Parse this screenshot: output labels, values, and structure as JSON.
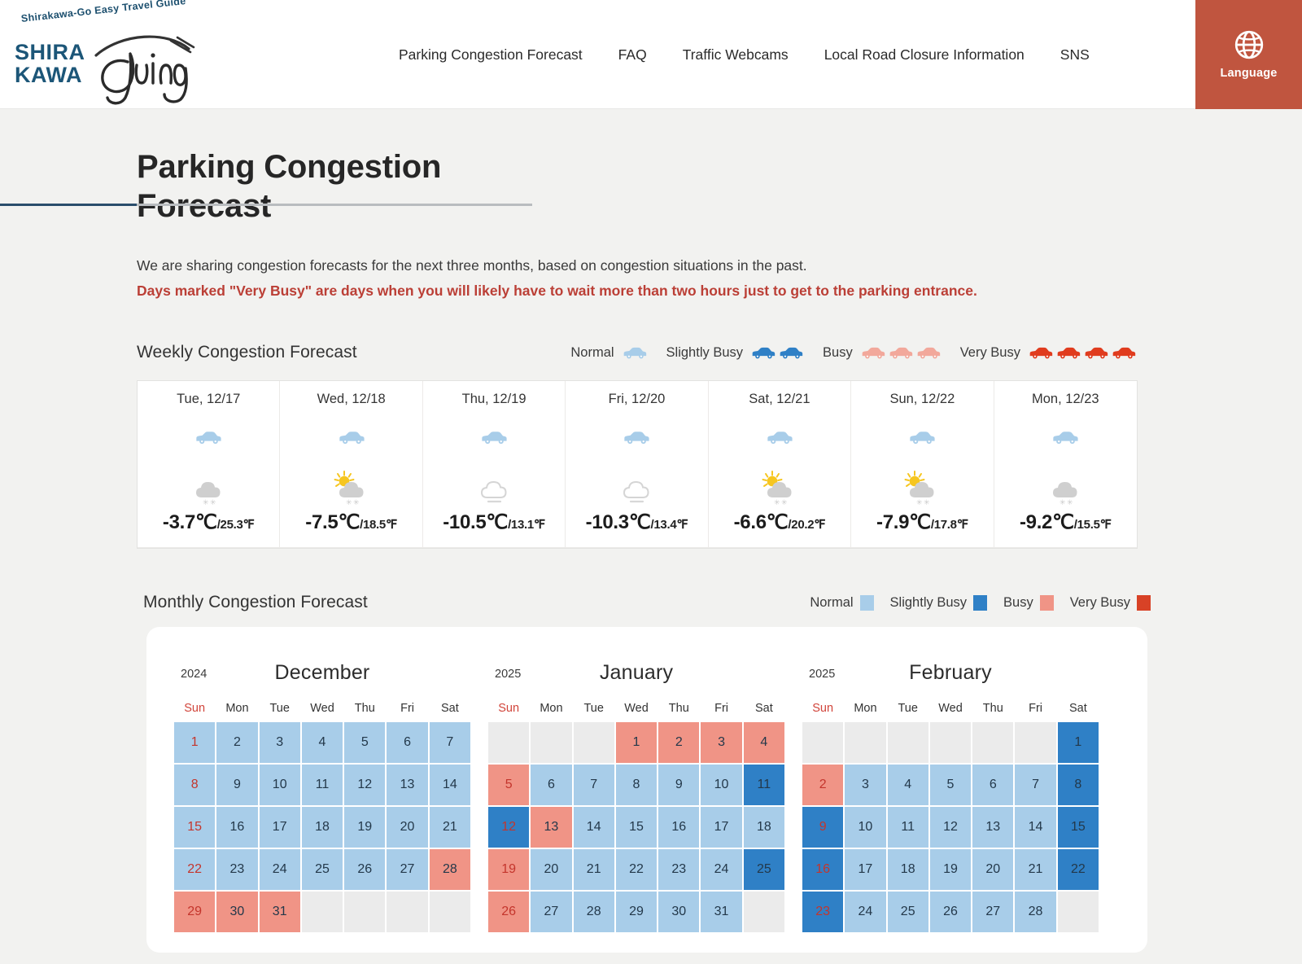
{
  "header": {
    "logo": {
      "tagline": "Shirakawa-Go Easy Travel Guide",
      "name_line1": "SHIRA",
      "name_line2": "KAWA",
      "script_word": "Going"
    },
    "nav": [
      {
        "label": "Parking Congestion Forecast"
      },
      {
        "label": "FAQ"
      },
      {
        "label": "Traffic Webcams"
      },
      {
        "label": "Local Road Closure Information"
      },
      {
        "label": "SNS"
      }
    ],
    "language_button": {
      "label": "Language",
      "icon": "globe-icon",
      "bg_color": "#c0553f"
    }
  },
  "page": {
    "title": "Parking Congestion Forecast",
    "intro_line1": "We are sharing congestion forecasts for the next three months, based on congestion situations in the past.",
    "intro_warning": "Days marked \"Very Busy\" are days when you will likely have to wait more than two hours just to get to the parking entrance."
  },
  "weekly": {
    "section_title": "Weekly Congestion Forecast",
    "legend": [
      {
        "label": "Normal",
        "cars": 1,
        "color": "#a8cde9"
      },
      {
        "label": "Slightly Busy",
        "cars": 2,
        "color": "#2f80c6"
      },
      {
        "label": "Busy",
        "cars": 3,
        "color": "#f2a89b"
      },
      {
        "label": "Very Busy",
        "cars": 4,
        "color": "#e03c1e"
      }
    ],
    "days": [
      {
        "date": "Tue, 12/17",
        "level": "Normal",
        "car_color": "#a8cde9",
        "weather": "snow-cloud-icon",
        "temp_c": "-3.7℃",
        "temp_f": "/25.3℉"
      },
      {
        "date": "Wed, 12/18",
        "level": "Normal",
        "car_color": "#a8cde9",
        "weather": "sun-snow-cloud-icon",
        "temp_c": "-7.5℃",
        "temp_f": "/18.5℉"
      },
      {
        "date": "Thu, 12/19",
        "level": "Normal",
        "car_color": "#a8cde9",
        "weather": "cloud-icon",
        "temp_c": "-10.5℃",
        "temp_f": "/13.1℉"
      },
      {
        "date": "Fri, 12/20",
        "level": "Normal",
        "car_color": "#a8cde9",
        "weather": "cloud-icon",
        "temp_c": "-10.3℃",
        "temp_f": "/13.4℉"
      },
      {
        "date": "Sat, 12/21",
        "level": "Normal",
        "car_color": "#a8cde9",
        "weather": "sun-snow-cloud-icon",
        "temp_c": "-6.6℃",
        "temp_f": "/20.2℉"
      },
      {
        "date": "Sun, 12/22",
        "level": "Normal",
        "car_color": "#a8cde9",
        "weather": "sun-snow-cloud-icon",
        "temp_c": "-7.9℃",
        "temp_f": "/17.8℉"
      },
      {
        "date": "Mon, 12/23",
        "level": "Normal",
        "car_color": "#a8cde9",
        "weather": "snow-cloud-icon",
        "temp_c": "-9.2℃",
        "temp_f": "/15.5℉"
      }
    ]
  },
  "monthly": {
    "section_title": "Monthly Congestion Forecast",
    "legend": [
      {
        "label": "Normal",
        "color": "#a8cde9"
      },
      {
        "label": "Slightly Busy",
        "color": "#2f80c6"
      },
      {
        "label": "Busy",
        "color": "#f09486"
      },
      {
        "label": "Very Busy",
        "color": "#d84226"
      }
    ],
    "dow": [
      "Sun",
      "Mon",
      "Tue",
      "Wed",
      "Thu",
      "Fri",
      "Sat"
    ],
    "months": [
      {
        "year": "2024",
        "name": "December",
        "lead_blanks": 0,
        "days": [
          {
            "n": "1",
            "lv": "normal"
          },
          {
            "n": "2",
            "lv": "normal"
          },
          {
            "n": "3",
            "lv": "normal"
          },
          {
            "n": "4",
            "lv": "normal"
          },
          {
            "n": "5",
            "lv": "normal"
          },
          {
            "n": "6",
            "lv": "normal"
          },
          {
            "n": "7",
            "lv": "normal"
          },
          {
            "n": "8",
            "lv": "normal"
          },
          {
            "n": "9",
            "lv": "normal"
          },
          {
            "n": "10",
            "lv": "normal"
          },
          {
            "n": "11",
            "lv": "normal"
          },
          {
            "n": "12",
            "lv": "normal"
          },
          {
            "n": "13",
            "lv": "normal"
          },
          {
            "n": "14",
            "lv": "normal"
          },
          {
            "n": "15",
            "lv": "normal"
          },
          {
            "n": "16",
            "lv": "normal"
          },
          {
            "n": "17",
            "lv": "normal"
          },
          {
            "n": "18",
            "lv": "normal"
          },
          {
            "n": "19",
            "lv": "normal"
          },
          {
            "n": "20",
            "lv": "normal"
          },
          {
            "n": "21",
            "lv": "normal"
          },
          {
            "n": "22",
            "lv": "normal"
          },
          {
            "n": "23",
            "lv": "normal"
          },
          {
            "n": "24",
            "lv": "normal"
          },
          {
            "n": "25",
            "lv": "normal"
          },
          {
            "n": "26",
            "lv": "normal"
          },
          {
            "n": "27",
            "lv": "normal"
          },
          {
            "n": "28",
            "lv": "busy"
          },
          {
            "n": "29",
            "lv": "busy"
          },
          {
            "n": "30",
            "lv": "busy"
          },
          {
            "n": "31",
            "lv": "busy"
          }
        ]
      },
      {
        "year": "2025",
        "name": "January",
        "lead_blanks": 3,
        "days": [
          {
            "n": "1",
            "lv": "busy"
          },
          {
            "n": "2",
            "lv": "busy"
          },
          {
            "n": "3",
            "lv": "busy"
          },
          {
            "n": "4",
            "lv": "busy"
          },
          {
            "n": "5",
            "lv": "busy"
          },
          {
            "n": "6",
            "lv": "normal"
          },
          {
            "n": "7",
            "lv": "normal"
          },
          {
            "n": "8",
            "lv": "normal"
          },
          {
            "n": "9",
            "lv": "normal"
          },
          {
            "n": "10",
            "lv": "normal"
          },
          {
            "n": "11",
            "lv": "slight"
          },
          {
            "n": "12",
            "lv": "slight"
          },
          {
            "n": "13",
            "lv": "busy"
          },
          {
            "n": "14",
            "lv": "normal"
          },
          {
            "n": "15",
            "lv": "normal"
          },
          {
            "n": "16",
            "lv": "normal"
          },
          {
            "n": "17",
            "lv": "normal"
          },
          {
            "n": "18",
            "lv": "normal"
          },
          {
            "n": "19",
            "lv": "busy"
          },
          {
            "n": "20",
            "lv": "normal"
          },
          {
            "n": "21",
            "lv": "normal"
          },
          {
            "n": "22",
            "lv": "normal"
          },
          {
            "n": "23",
            "lv": "normal"
          },
          {
            "n": "24",
            "lv": "normal"
          },
          {
            "n": "25",
            "lv": "slight"
          },
          {
            "n": "26",
            "lv": "busy"
          },
          {
            "n": "27",
            "lv": "normal"
          },
          {
            "n": "28",
            "lv": "normal"
          },
          {
            "n": "29",
            "lv": "normal"
          },
          {
            "n": "30",
            "lv": "normal"
          },
          {
            "n": "31",
            "lv": "normal"
          }
        ]
      },
      {
        "year": "2025",
        "name": "February",
        "lead_blanks": 6,
        "days": [
          {
            "n": "1",
            "lv": "slight"
          },
          {
            "n": "2",
            "lv": "busy"
          },
          {
            "n": "3",
            "lv": "normal"
          },
          {
            "n": "4",
            "lv": "normal"
          },
          {
            "n": "5",
            "lv": "normal"
          },
          {
            "n": "6",
            "lv": "normal"
          },
          {
            "n": "7",
            "lv": "normal"
          },
          {
            "n": "8",
            "lv": "slight"
          },
          {
            "n": "9",
            "lv": "slight"
          },
          {
            "n": "10",
            "lv": "normal"
          },
          {
            "n": "11",
            "lv": "normal"
          },
          {
            "n": "12",
            "lv": "normal"
          },
          {
            "n": "13",
            "lv": "normal"
          },
          {
            "n": "14",
            "lv": "normal"
          },
          {
            "n": "15",
            "lv": "slight"
          },
          {
            "n": "16",
            "lv": "slight"
          },
          {
            "n": "17",
            "lv": "normal"
          },
          {
            "n": "18",
            "lv": "normal"
          },
          {
            "n": "19",
            "lv": "normal"
          },
          {
            "n": "20",
            "lv": "normal"
          },
          {
            "n": "21",
            "lv": "normal"
          },
          {
            "n": "22",
            "lv": "slight"
          },
          {
            "n": "23",
            "lv": "slight"
          },
          {
            "n": "24",
            "lv": "normal"
          },
          {
            "n": "25",
            "lv": "normal"
          },
          {
            "n": "26",
            "lv": "normal"
          },
          {
            "n": "27",
            "lv": "normal"
          },
          {
            "n": "28",
            "lv": "normal"
          }
        ]
      }
    ]
  }
}
